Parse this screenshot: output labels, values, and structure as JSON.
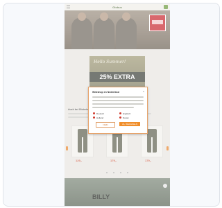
{
  "shop": {
    "title": "Globus",
    "promo": {
      "script_text": "Hello Summer!",
      "headline": "25% EXTRA"
    },
    "section_title": "Auch bei Globetrotter",
    "products": [
      {
        "price": "129,-"
      },
      {
        "price": "179,-"
      },
      {
        "price": "179,-"
      }
    ],
    "bottom_banner_text": "BILLY"
  },
  "modal": {
    "title": "Webshop en Nederland",
    "close_label": "×",
    "options": [
      {
        "label": "Deutsch"
      },
      {
        "label": "Englisch"
      },
      {
        "label": "Holland"
      },
      {
        "label": "Dansk"
      }
    ],
    "secondary_button": "NEIN",
    "primary_button": "JA, WECHSELN"
  },
  "colors": {
    "accent": "#f08e2a",
    "brand_green": "#6a9a3b",
    "price_red": "#d0482f"
  }
}
